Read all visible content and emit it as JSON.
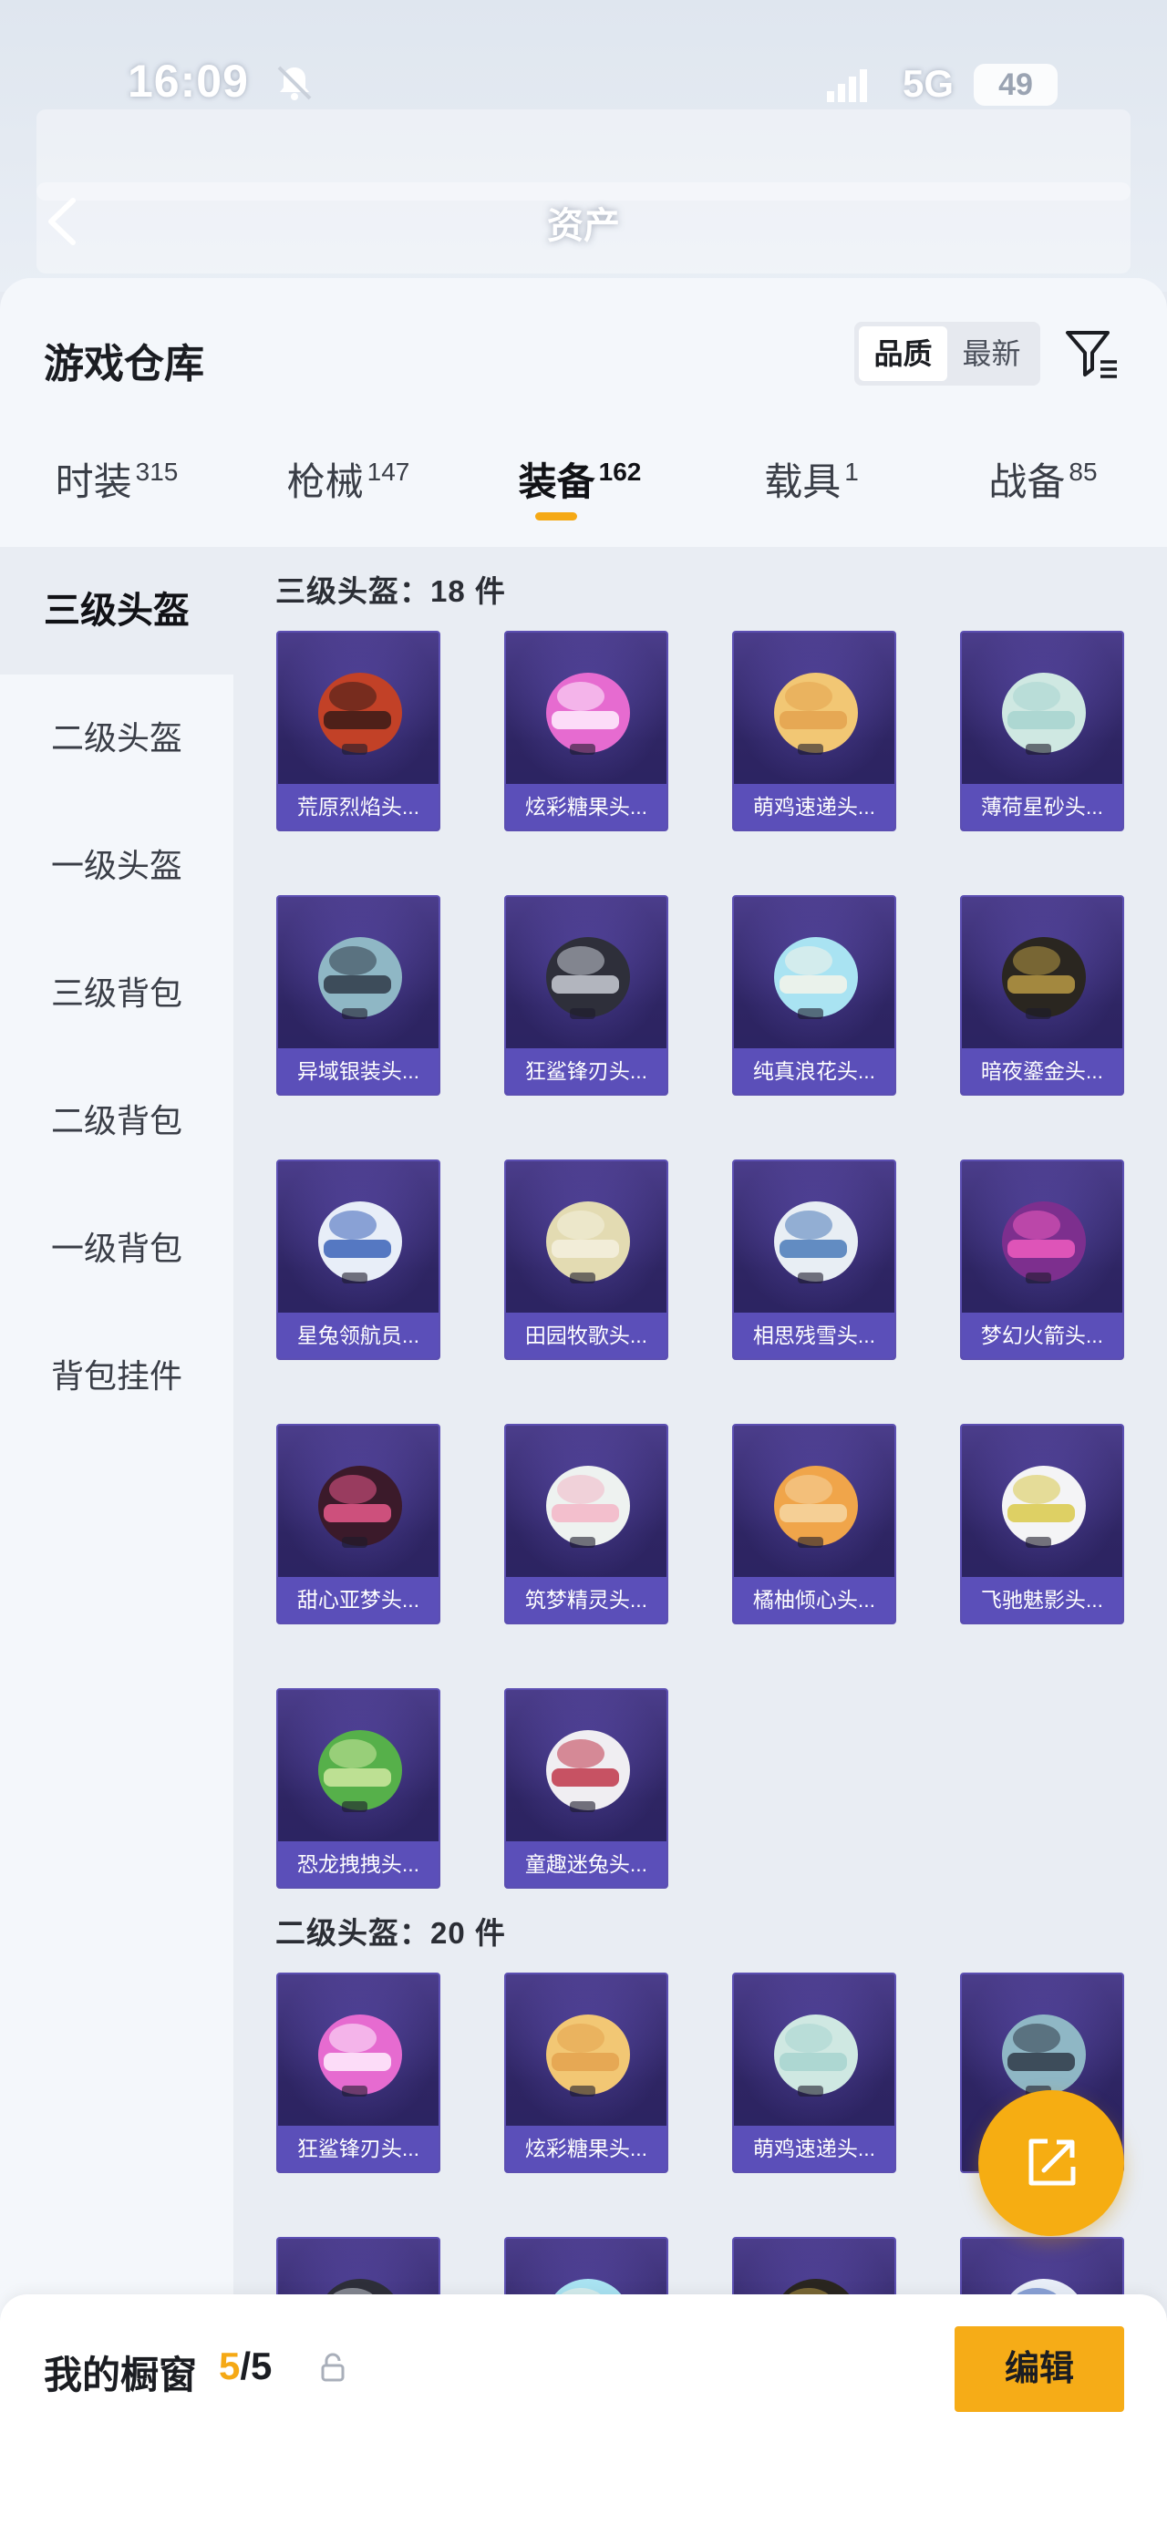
{
  "status_bar": {
    "time": "16:09",
    "network": "5G",
    "battery": "49"
  },
  "header": {
    "title": "资产"
  },
  "sheet": {
    "title": "游戏仓库",
    "sort_options": [
      "品质",
      "最新"
    ],
    "tabs": [
      {
        "label": "时装",
        "count": "315"
      },
      {
        "label": "枪械",
        "count": "147"
      },
      {
        "label": "装备",
        "count": "162"
      },
      {
        "label": "载具",
        "count": "1"
      },
      {
        "label": "战备",
        "count": "85"
      }
    ]
  },
  "sidebar": {
    "items": [
      "三级头盔",
      "二级头盔",
      "一级头盔",
      "三级背包",
      "二级背包",
      "一级背包",
      "背包挂件"
    ]
  },
  "sections": [
    {
      "title": "三级头盔：18 件",
      "items": [
        "荒原烈焰头...",
        "炫彩糖果头...",
        "萌鸡速递头...",
        "薄荷星砂头...",
        "异域银装头...",
        "狂鲨锋刃头...",
        "纯真浪花头...",
        "暗夜鎏金头...",
        "星兔领航员...",
        "田园牧歌头...",
        "相思残雪头...",
        "梦幻火箭头...",
        "甜心亚梦头...",
        "筑梦精灵头...",
        "橘柚倾心头...",
        "飞驰魅影头...",
        "恐龙拽拽头...",
        "童趣迷兔头..."
      ]
    },
    {
      "title": "二级头盔：20 件",
      "items": [
        "狂鲨锋刃头...",
        "炫彩糖果头...",
        "萌鸡速递头...",
        "",
        "",
        "",
        "",
        ""
      ]
    }
  ],
  "bottom_bar": {
    "label": "我的橱窗",
    "count_current": "5",
    "count_total": "/5",
    "edit_label": "编辑"
  },
  "colors": {
    "accent": "#f5a915",
    "card_bg": "#2e2563",
    "card_label": "#5b4fb9"
  }
}
